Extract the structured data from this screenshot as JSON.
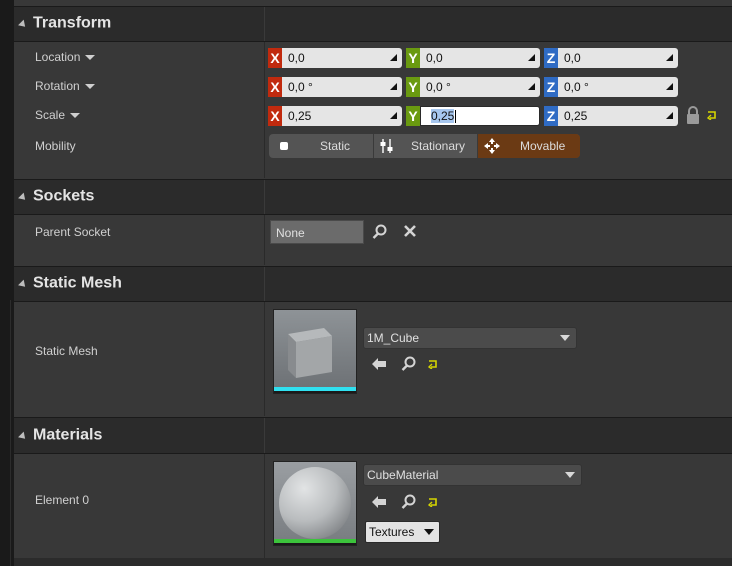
{
  "transform": {
    "title": "Transform",
    "location": {
      "label": "Location",
      "x": "0,0",
      "y": "0,0",
      "z": "0,0"
    },
    "rotation": {
      "label": "Rotation",
      "x": "0,0 °",
      "y": "0,0 °",
      "z": "0,0 °"
    },
    "scale": {
      "label": "Scale",
      "x": "0,25",
      "y": "0,25",
      "z": "0,25"
    },
    "axis": {
      "x": "X",
      "y": "Y",
      "z": "Z"
    },
    "mobility": {
      "label": "Mobility",
      "options": [
        "Static",
        "Stationary",
        "Movable"
      ],
      "selected": "Movable"
    }
  },
  "sockets": {
    "title": "Sockets",
    "parent_socket": {
      "label": "Parent Socket",
      "value": "None"
    }
  },
  "static_mesh": {
    "title": "Static Mesh",
    "label": "Static Mesh",
    "asset": "1M_Cube"
  },
  "materials": {
    "title": "Materials",
    "element_label": "Element 0",
    "asset": "CubeMaterial",
    "textures_button": "Textures"
  },
  "colors": {
    "x_axis": "#c12a0e",
    "y_axis": "#6a9a10",
    "z_axis": "#2f6bc4",
    "movable_active": "#6b3a14",
    "mesh_thumb_bar": "#30e0f0",
    "material_thumb_bar": "#3cc43c"
  },
  "icons": [
    "dropdown-arrow",
    "lock-icon",
    "reset-arrow-icon",
    "stationary-sliders-icon",
    "move-arrows-icon",
    "search-icon",
    "clear-x-icon",
    "back-arrow-icon"
  ]
}
